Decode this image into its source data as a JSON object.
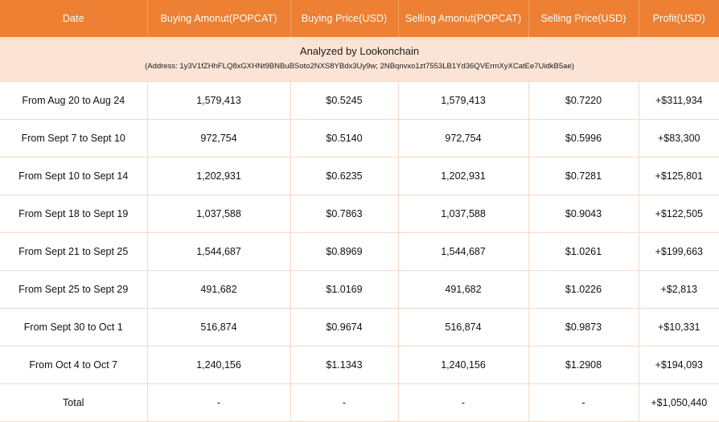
{
  "table": {
    "columns": [
      {
        "key": "date",
        "label": "Date"
      },
      {
        "key": "buying_amount",
        "label": "Buying Amonut(POPCAT)"
      },
      {
        "key": "buying_price",
        "label": "Buying Price(USD)"
      },
      {
        "key": "selling_amount",
        "label": "Selling Amonut(POPCAT)"
      },
      {
        "key": "selling_price",
        "label": "Selling Price(USD)"
      },
      {
        "key": "profit",
        "label": "Profit(USD)"
      }
    ],
    "banner": {
      "title": "Analyzed by Lookonchain",
      "address_line": "(Address: 1y3V1fZHhFLQ8xGXHNt9BNBuBSoto2NXS8YBdx3Uy9w; 2NBqnvxo1zt7553LB1Yd36QVErmXyXCatEe7UidkB5ae)"
    },
    "rows": [
      {
        "date": "From Aug 20 to Aug 24",
        "buying_amount": "1,579,413",
        "buying_price": "$0.5245",
        "selling_amount": "1,579,413",
        "selling_price": "$0.7220",
        "profit": "+$311,934"
      },
      {
        "date": "From Sept 7 to Sept 10",
        "buying_amount": "972,754",
        "buying_price": "$0.5140",
        "selling_amount": "972,754",
        "selling_price": "$0.5996",
        "profit": "+$83,300"
      },
      {
        "date": "From Sept 10 to Sept 14",
        "buying_amount": "1,202,931",
        "buying_price": "$0.6235",
        "selling_amount": "1,202,931",
        "selling_price": "$0.7281",
        "profit": "+$125,801"
      },
      {
        "date": "From Sept 18 to Sept 19",
        "buying_amount": "1,037,588",
        "buying_price": "$0.7863",
        "selling_amount": "1,037,588",
        "selling_price": "$0.9043",
        "profit": "+$122,505"
      },
      {
        "date": "From Sept 21 to Sept 25",
        "buying_amount": "1,544,687",
        "buying_price": "$0.8969",
        "selling_amount": "1,544,687",
        "selling_price": "$1.0261",
        "profit": "+$199,663"
      },
      {
        "date": "From Sept 25 to Sept 29",
        "buying_amount": "491,682",
        "buying_price": "$1.0169",
        "selling_amount": "491,682",
        "selling_price": "$1.0226",
        "profit": "+$2,813"
      },
      {
        "date": "From Sept 30 to Oct 1",
        "buying_amount": "516,874",
        "buying_price": "$0.9674",
        "selling_amount": "516,874",
        "selling_price": "$0.9873",
        "profit": "+$10,331"
      },
      {
        "date": "From Oct 4 to Oct 7",
        "buying_amount": "1,240,156",
        "buying_price": "$1.1343",
        "selling_amount": "1,240,156",
        "selling_price": "$1.2908",
        "profit": "+$194,093"
      },
      {
        "date": "Total",
        "buying_amount": "-",
        "buying_price": "-",
        "selling_amount": "-",
        "selling_price": "-",
        "profit": "+$1,050,440"
      }
    ]
  },
  "colors": {
    "header_background": "#ED8033",
    "header_text": "#FFFFFF",
    "banner_background": "#FBE4D5",
    "grid_line": "#F7D9C4",
    "profit_text": "#1DB36E",
    "cell_text": "#111111"
  }
}
